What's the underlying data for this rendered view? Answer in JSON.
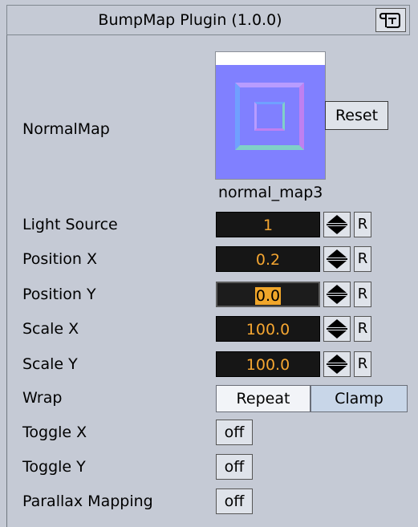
{
  "title": "BumpMap Plugin (1.0.0)",
  "icons": {
    "title_icon": "script-icon"
  },
  "normal_map": {
    "label": "NormalMap",
    "reset_label": "Reset",
    "map_name": "normal_map3"
  },
  "params": [
    {
      "label": "Light Source",
      "value": "1"
    },
    {
      "label": "Position X",
      "value": "0.2"
    },
    {
      "label": "Position Y",
      "value": "0.0"
    },
    {
      "label": "Scale X",
      "value": "100.0"
    },
    {
      "label": "Scale Y",
      "value": "100.0"
    }
  ],
  "reset_param_label": "R",
  "wrap": {
    "label": "Wrap",
    "options": [
      "Repeat",
      "Clamp"
    ],
    "selected": "Repeat"
  },
  "toggles": [
    {
      "label": "Toggle X",
      "value": "off"
    },
    {
      "label": "Toggle Y",
      "value": "off"
    },
    {
      "label": "Parallax Mapping",
      "value": "off"
    }
  ],
  "colors": {
    "panel_bg": "#c5cad5",
    "field_bg": "#161616",
    "field_text": "#f5a631",
    "normal_map_base": "#8080ff"
  }
}
